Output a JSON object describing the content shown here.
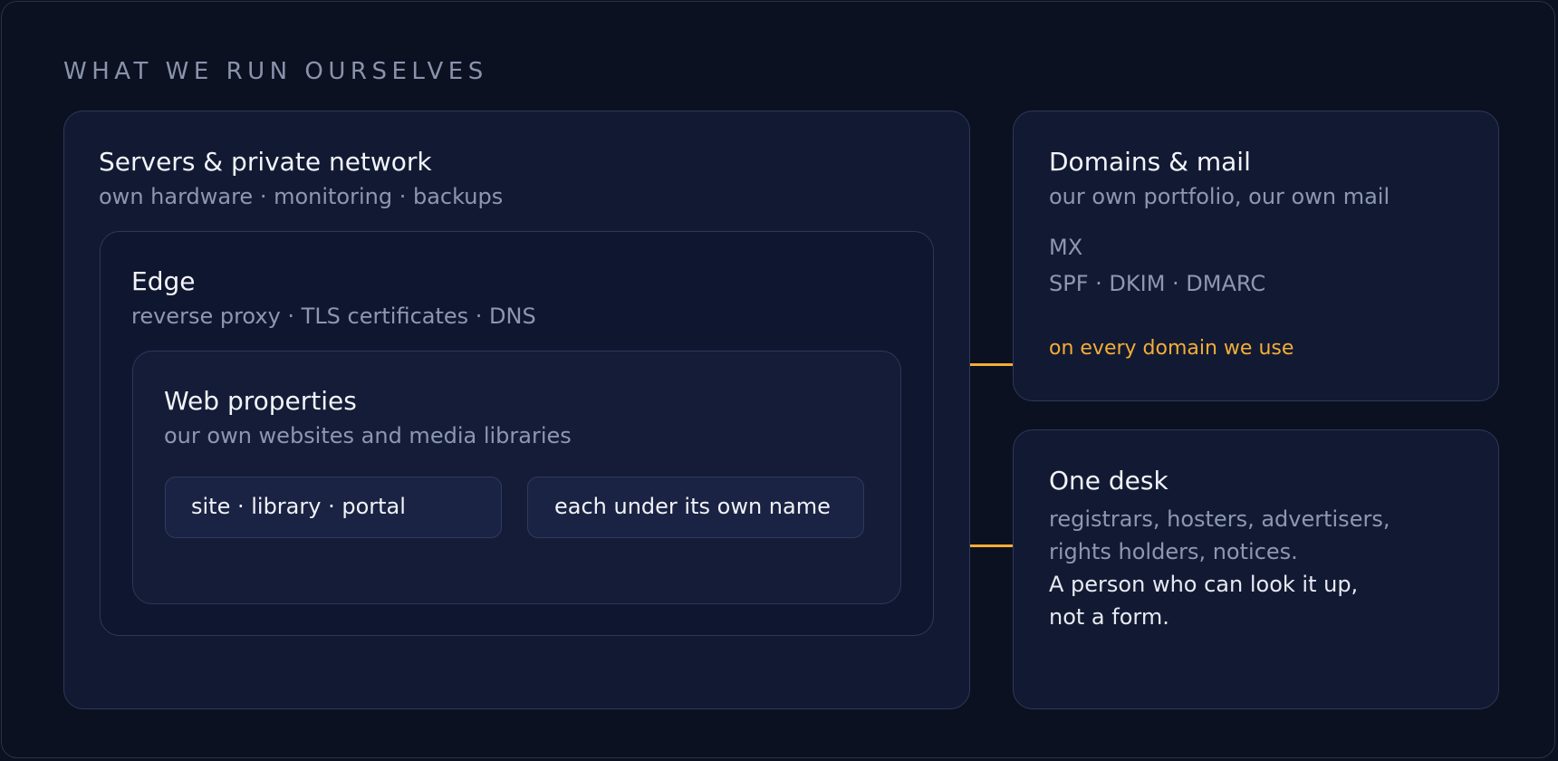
{
  "heading": "WHAT WE RUN OURSELVES",
  "servers": {
    "title": "Servers & private network",
    "subtitle": "own hardware · monitoring · backups"
  },
  "edge": {
    "title": "Edge",
    "subtitle": "reverse proxy · TLS certificates · DNS"
  },
  "web": {
    "title": "Web properties",
    "subtitle": "our own websites and media libraries",
    "chips": [
      "site · library · portal",
      "each under its own name"
    ]
  },
  "domains": {
    "title": "Domains & mail",
    "subtitle": "our own portfolio, our own mail",
    "records": [
      "MX",
      "SPF · DKIM · DMARC"
    ],
    "note": "on every domain we use"
  },
  "desk": {
    "title": "One desk",
    "lines_muted": [
      "registrars, hosters, advertisers,",
      "rights holders, notices."
    ],
    "lines_plain": [
      "A person who can look it up,",
      "not a form."
    ]
  },
  "colors": {
    "background": "#0b1120",
    "panel": "#121a33",
    "border": "#2d3859",
    "accent": "#f4ad37",
    "muted_text": "#8e97b1",
    "text": "#f2f4f9"
  }
}
